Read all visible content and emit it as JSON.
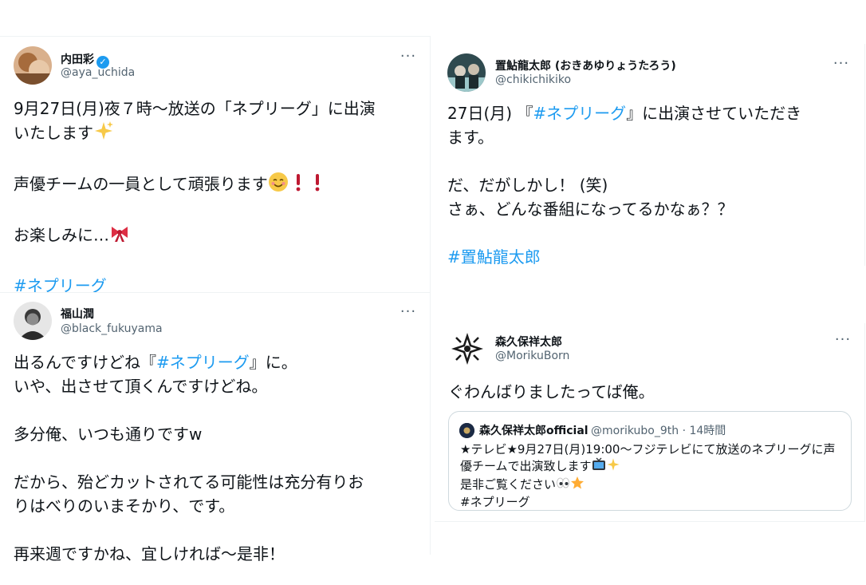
{
  "tweets": {
    "uchida": {
      "name": "内田彩",
      "handle": "@aya_uchida",
      "line1": "9月27日(月)夜７時〜放送の「ネプリーグ」に出演",
      "line2": "いたします",
      "line3": "声優チームの一員として頑張ります",
      "line4": "お楽しみに…",
      "hashtag": "#ネプリーグ"
    },
    "okiayu": {
      "name": "置鮎龍太郎 (おきあゆりょうたろう)",
      "handle": "@chikichikiko",
      "line1_pre": "27日(月) 『",
      "line1_tag": "#ネプリーグ",
      "line1_post": "』に出演させていただき",
      "line2": "ます。",
      "line3": "だ、だがしかし！ (笑)",
      "line4": "さぁ、どんな番組になってるかなぁ？？",
      "hashtag": "#置鮎龍太郎"
    },
    "fukuyama": {
      "name": "福山潤",
      "handle": "@black_fukuyama",
      "line1_pre": "出るんですけどね『",
      "line1_tag": "#ネプリーグ",
      "line1_post": "』に。",
      "line2": "いや、出させて頂くんですけどね。",
      "line3": "多分俺、いつも通りですw",
      "line4": "だから、殆どカットされてる可能性は充分有りお",
      "line5": "りはべりのいまそかり、です。",
      "line6": "再来週ですかね、宜しければ〜是非！"
    },
    "morikubo": {
      "name": "森久保祥太郎",
      "handle": "@MorikuBorn",
      "text": "ぐわんばりましたってば俺。",
      "quote": {
        "name": "森久保祥太郎official",
        "meta": "@morikubo_9th · 14時間",
        "line1": "★テレビ★9月27日(月)19:00〜フジテレビにて放送のネプリーグに声",
        "line2": "優チームで出演致します",
        "line3": "是非ご覧ください",
        "line4": "#ネプリーグ"
      }
    }
  },
  "more_label": "···",
  "icons": [
    "verified-badge-icon",
    "sparkles-icon",
    "smiling-face-icon",
    "exclamation-icon",
    "ribbon-icon",
    "television-icon",
    "eyes-icon",
    "star-icon",
    "more-options-icon"
  ],
  "colors": {
    "hashtag": "#1d9bf0",
    "secondary_text": "#536471",
    "border": "#eff3f4"
  }
}
